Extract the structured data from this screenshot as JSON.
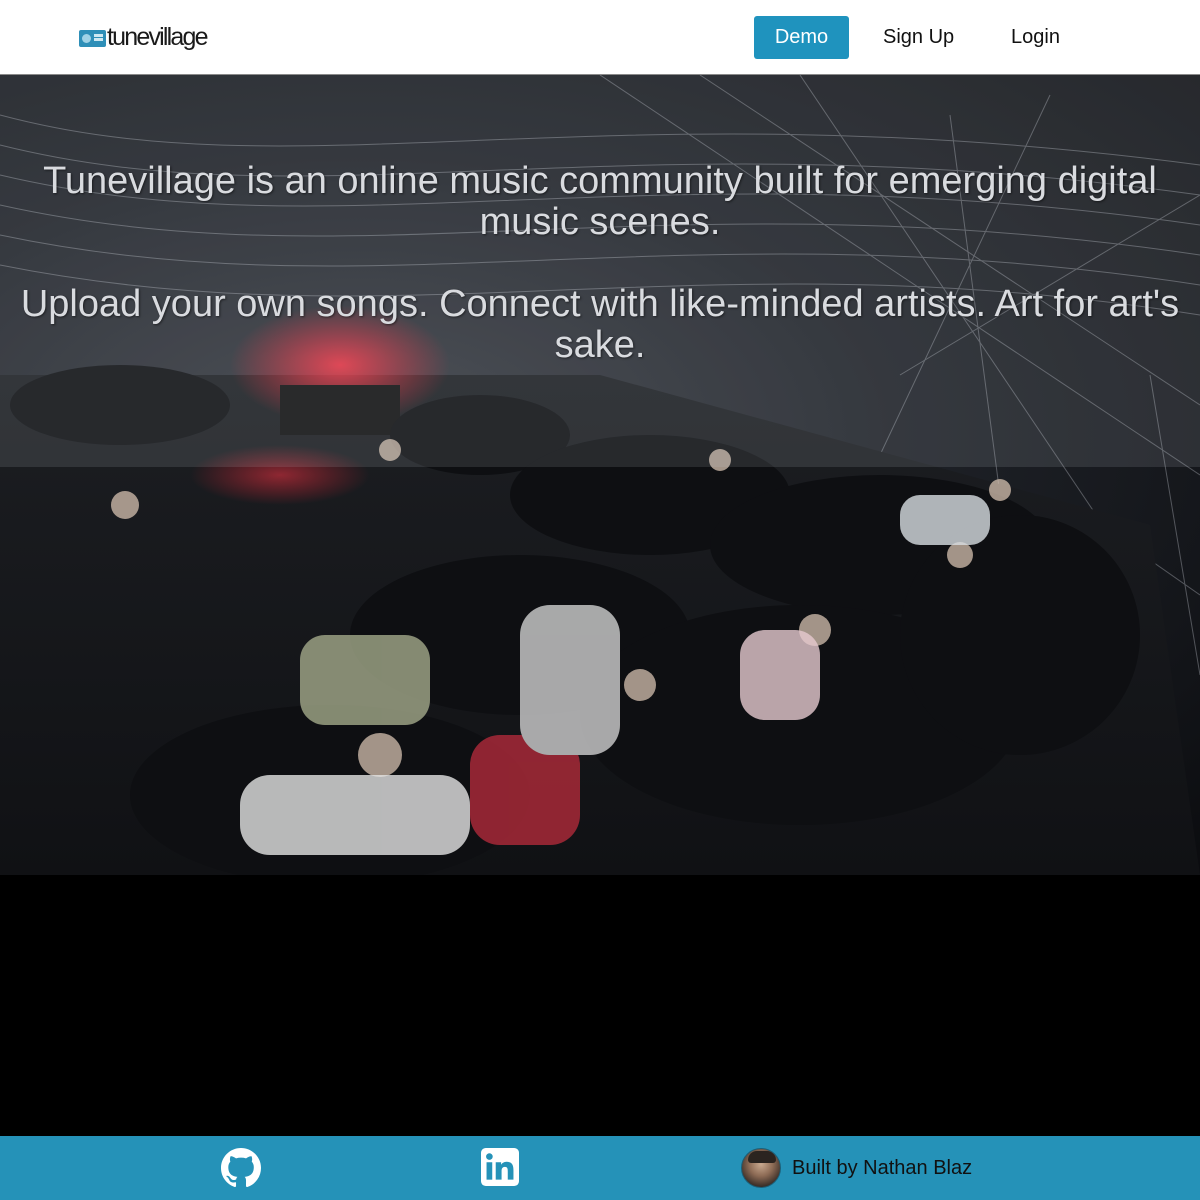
{
  "header": {
    "logo_text": "tunevillage",
    "demo_label": "Demo",
    "signup_label": "Sign Up",
    "login_label": "Login"
  },
  "hero": {
    "tagline": "Tunevillage is an online music community built for emerging digital music scenes.",
    "subline": "Upload your own songs. Connect with like-minded artists. Art for art's sake."
  },
  "footer": {
    "credit_text": "Built by Nathan Blaz"
  },
  "colors": {
    "accent": "#1f93be",
    "footer_bg": "#2592b8"
  }
}
